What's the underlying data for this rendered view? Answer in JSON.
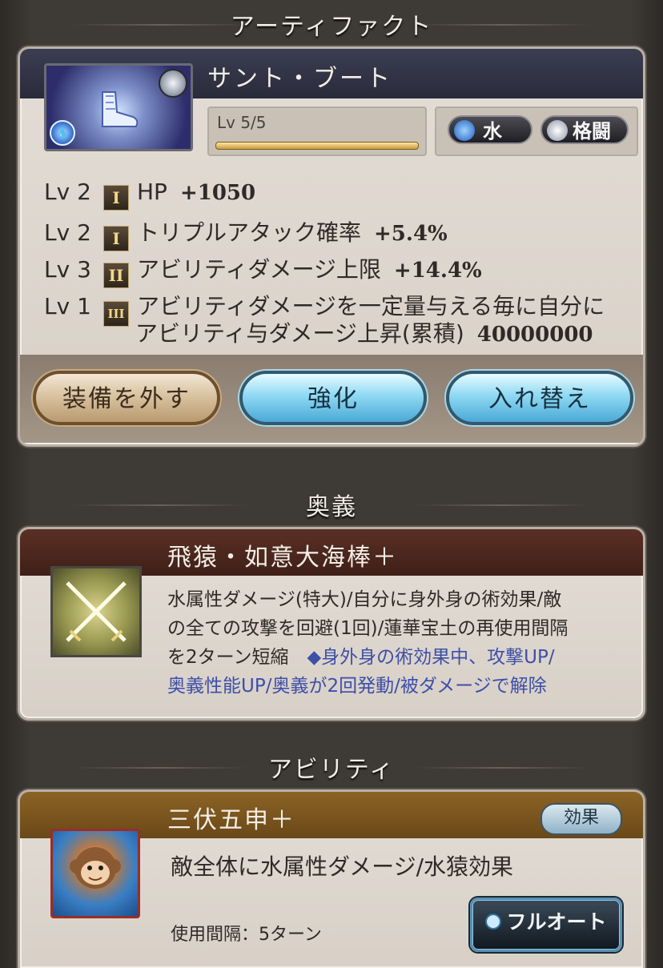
{
  "sections": {
    "artifact_title": "アーティファクト",
    "ougi_title": "奥義",
    "ability_title": "アビリティ"
  },
  "artifact": {
    "name": "サント・ブート",
    "level": "Lv 5/5",
    "tags": [
      "水",
      "格闘"
    ],
    "stats": [
      {
        "lv": "Lv 2",
        "rank": "I",
        "label": "HP",
        "value": "+1050"
      },
      {
        "lv": "Lv 2",
        "rank": "I",
        "label": "トリプルアタック確率",
        "value": "+5.4%"
      },
      {
        "lv": "Lv 3",
        "rank": "II",
        "label": "アビリティダメージ上限",
        "value": "+14.4%"
      },
      {
        "lv": "Lv 1",
        "rank": "III",
        "label": "アビリティダメージを一定量与える毎に自分に",
        "label2": "アビリティ与ダメージ上昇(累積)",
        "value": "40000000"
      }
    ],
    "buttons": {
      "unequip": "装備を外す",
      "enhance": "強化",
      "swap": "入れ替え"
    }
  },
  "ougi": {
    "name": "飛猿・如意大海棒＋",
    "desc_line1": "水属性ダメージ(特大)/自分に身外身の術効果/敵",
    "desc_line2": "の全ての攻撃を回避(1回)/蓮華宝土の再使用間隔",
    "desc_line3": "を2ターン短縮",
    "note_line1": "◆身外身の術効果中、攻撃UP/",
    "note_line2": "奥義性能UP/奥義が2回発動/被ダメージで解除"
  },
  "ability": {
    "name": "三伏五申＋",
    "effect_label": "効果",
    "desc": "敵全体に水属性ダメージ/水猿効果",
    "cooldown": "使用間隔：5ターン",
    "fullauto_label": "フルオート"
  }
}
